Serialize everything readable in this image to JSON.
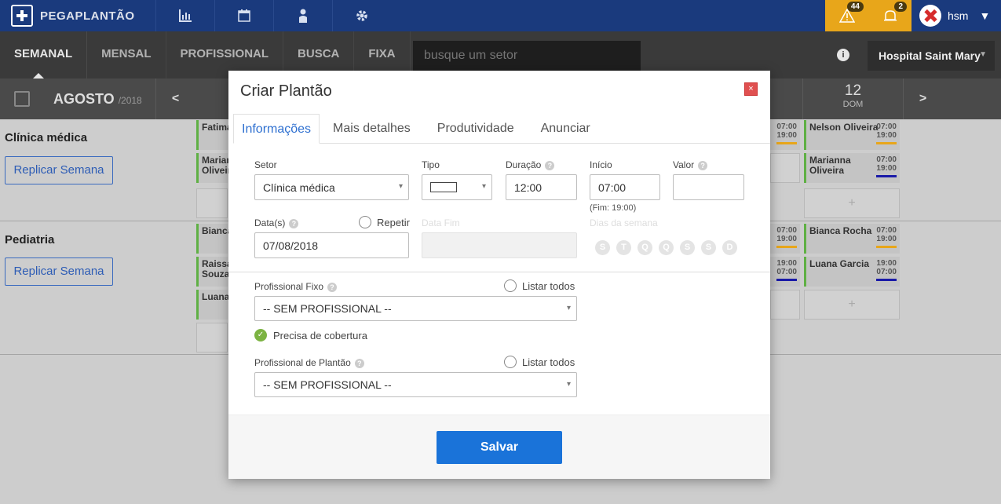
{
  "app": {
    "logo_text": "PEGAPLANTÃO"
  },
  "topnav": {
    "icons": [
      "chart-icon",
      "calendar-icon",
      "user-icon",
      "gear-icon"
    ]
  },
  "alerts": {
    "warnings": "44",
    "notifications": "2"
  },
  "user": {
    "name": "hsm"
  },
  "viewtabs": [
    "SEMANAL",
    "MENSAL",
    "PROFISSIONAL",
    "BUSCA",
    "FIXA"
  ],
  "search": {
    "placeholder": "busque um setor"
  },
  "hospital": {
    "name": "Hospital Saint Mary"
  },
  "calendar": {
    "month": "AGOSTO",
    "year": "/2018",
    "prev": "<",
    "next": ">",
    "day_num": "12",
    "day_name": "DOM"
  },
  "sectors": [
    {
      "name": "Clínica médica",
      "replicate_label": "Replicar Semana",
      "left_shifts": [
        "Fatima",
        "Mariana Oliveira"
      ],
      "right_shifts": [
        {
          "name": "Nelson Oliveira",
          "start": "07:00",
          "end": "19:00",
          "color": "#e8a61a"
        },
        {
          "name": "Marianna Oliveira",
          "start": "07:00",
          "end": "19:00",
          "color": "#1a1aa8"
        }
      ],
      "mid_times": [
        {
          "start": "07:00",
          "end": "19:00",
          "color": "#e8a61a"
        }
      ],
      "add": "+"
    },
    {
      "name": "Pediatria",
      "replicate_label": "Replicar Semana",
      "left_shifts": [
        "Bianca",
        "Raissa Souza",
        "Luana"
      ],
      "right_shifts": [
        {
          "name": "Bianca Rocha",
          "start": "07:00",
          "end": "19:00",
          "color": "#e8a61a"
        },
        {
          "name": "Luana Garcia",
          "start": "19:00",
          "end": "07:00",
          "color": "#1a1aa8"
        }
      ],
      "mid_times": [
        {
          "start": "07:00",
          "end": "19:00",
          "color": "#e8a61a"
        },
        {
          "start": "19:00",
          "end": "07:00",
          "color": "#1a1aa8"
        }
      ],
      "add": "+"
    }
  ],
  "modal": {
    "title": "Criar Plantão",
    "close": "×",
    "tabs": [
      "Informações",
      "Mais detalhes",
      "Produtividade",
      "Anunciar"
    ],
    "setor_label": "Setor",
    "setor_value": "Clínica médica",
    "tipo_label": "Tipo",
    "duracao_label": "Duração",
    "duracao_value": "12:00",
    "inicio_label": "Início",
    "inicio_value": "07:00",
    "fim_text": "(Fim: 19:00)",
    "valor_label": "Valor",
    "valor_value": "",
    "datas_label": "Data(s)",
    "datas_value": "07/08/2018",
    "repetir_label": "Repetir",
    "data_fim_label": "Data Fim",
    "dias_label": "Dias da semana",
    "weekdays": [
      "S",
      "T",
      "Q",
      "Q",
      "S",
      "S",
      "D"
    ],
    "prof_fixo_label": "Profissional Fixo",
    "prof_fixo_value": "-- SEM PROFISSIONAL --",
    "listar_todos": "Listar todos",
    "cobertura_label": "Precisa de cobertura",
    "prof_plantao_label": "Profissional de Plantão",
    "prof_plantao_value": "-- SEM PROFISSIONAL --",
    "save_label": "Salvar"
  }
}
